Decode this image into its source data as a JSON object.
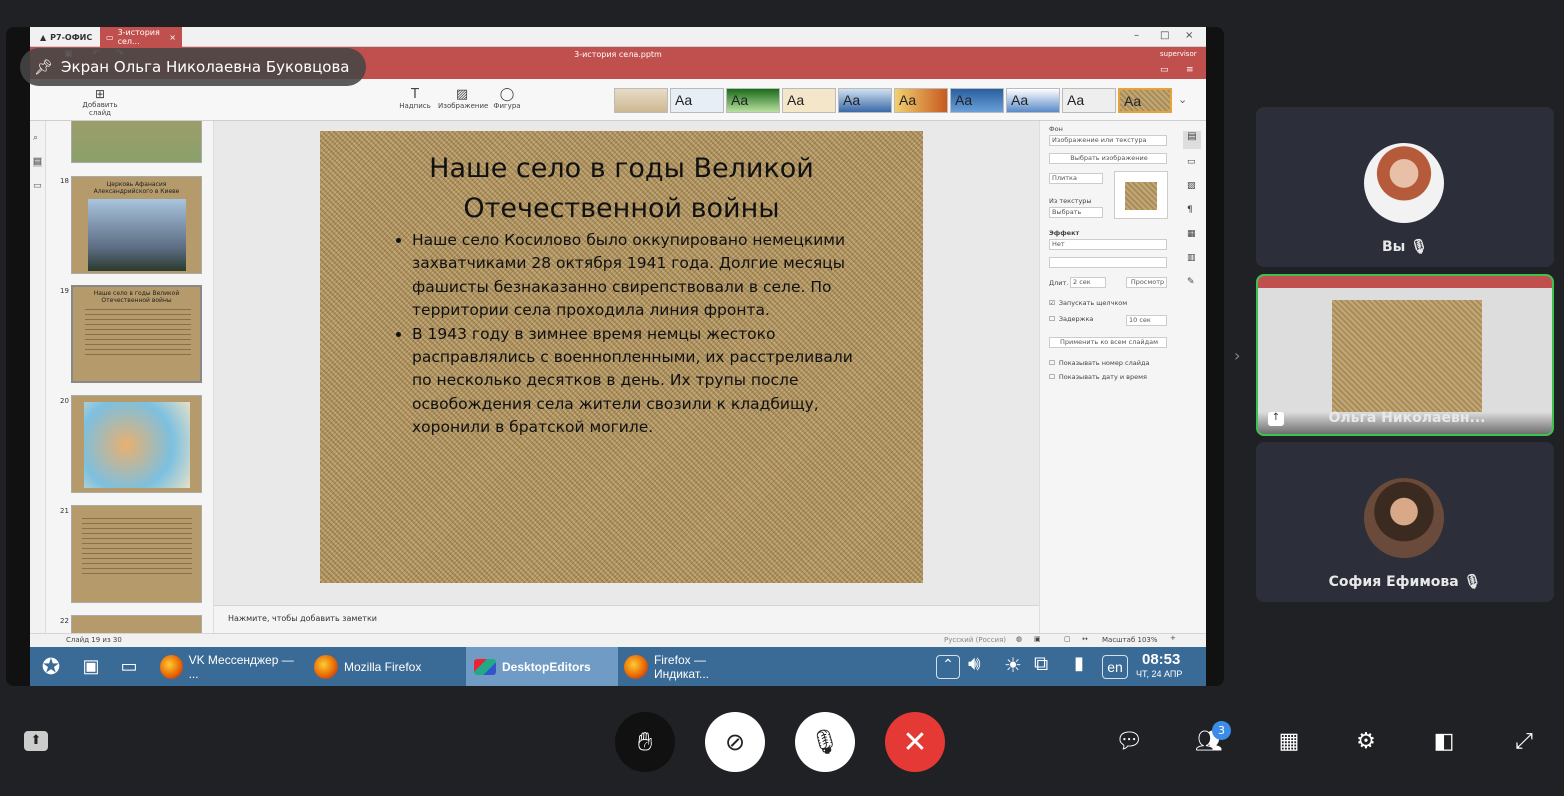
{
  "presenter_label": "Экран Ольга Николаевна Буковцова",
  "app": {
    "brand": "Р7-ОФИС",
    "tab_title": "3-история сел...",
    "window_title": "3-история села.pptm",
    "user": "supervisor",
    "ribbon": {
      "add_slide": "Добавить слайд",
      "textbox": "Надпись",
      "image": "Изображение",
      "shape": "Фигура",
      "theme_label": "Aa"
    },
    "thumbnails": [
      {
        "num": "18",
        "title": "Церковь Афанасия Александрийского в Киеве"
      },
      {
        "num": "19",
        "title": "Наше село в годы Великой Отечественной войны"
      },
      {
        "num": "20",
        "title": ""
      },
      {
        "num": "21",
        "title": ""
      },
      {
        "num": "22",
        "title": ""
      }
    ],
    "slide": {
      "title": "Наше село в годы Великой Отечественной войны",
      "bullets": [
        "Наше село Косилово было оккупировано немецкими захватчиками 28 октября 1941 года. Долгие месяцы фашисты безнаказанно свирепствовали в селе. По территории села проходила линия фронта.",
        "В 1943 году в зимнее время немцы жестоко расправлялись с военнопленными, их расстреливали по несколько десятков в день. Их трупы после освобождения села жители свозили к кладбищу, хоронили в братской могиле."
      ]
    },
    "notes_placeholder": "Нажмите, чтобы добавить заметки",
    "right_panel": {
      "fon_label": "Фон",
      "fill_type": "Изображение или текстура",
      "choose_image": "Выбрать изображение",
      "tile": "Плитка",
      "from_texture": "Из текстуры",
      "choose": "Выбрать",
      "effect_label": "Эффект",
      "effect_value": "Нет",
      "duration_label": "Длит.",
      "duration_value": "2 сек",
      "preview": "Просмотр",
      "start_on_click": "Запускать щелчком",
      "delay": "Задержка",
      "delay_value": "10 сек",
      "apply_all": "Применить ко всем слайдам",
      "show_slide_number": "Показывать номер слайда",
      "show_date": "Показывать дату и время"
    },
    "status": {
      "slide_of": "Слайд 19 из 30",
      "language": "Русский (Россия)",
      "zoom": "Масштаб 103%"
    },
    "taskbar": {
      "items": [
        "VK Мессенджер — ...",
        "Mozilla Firefox",
        "DesktopEditors",
        "Firefox — Индикат..."
      ],
      "lang": "en",
      "time": "08:53",
      "date": "ЧТ, 24 АПР"
    }
  },
  "participants": [
    {
      "name": "Вы"
    },
    {
      "name": "Ольга Николаевн..."
    },
    {
      "name": "София Ефимова"
    }
  ],
  "participants_badge": "3",
  "colors": {
    "accent_red": "#e53935",
    "active_green": "#3ec24f"
  }
}
